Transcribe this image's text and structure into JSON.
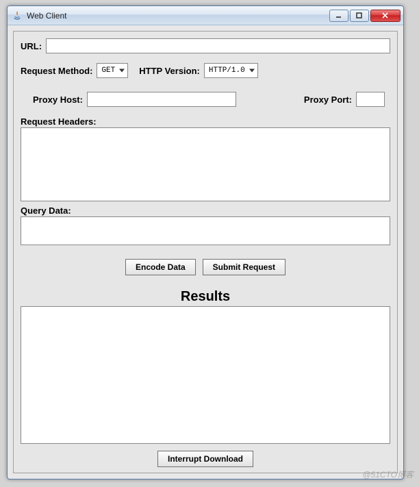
{
  "window": {
    "title": "Web Client"
  },
  "form": {
    "url_label": "URL:",
    "url_value": "",
    "method_label": "Request Method:",
    "method_selected": "GET",
    "http_version_label": "HTTP Version:",
    "http_version_selected": "HTTP/1.0",
    "proxy_host_label": "Proxy Host:",
    "proxy_host_value": "",
    "proxy_port_label": "Proxy Port:",
    "proxy_port_value": "",
    "request_headers_label": "Request Headers:",
    "request_headers_value": "",
    "query_data_label": "Query Data:",
    "query_data_value": ""
  },
  "buttons": {
    "encode": "Encode Data",
    "submit": "Submit Request",
    "interrupt": "Interrupt Download"
  },
  "results": {
    "heading": "Results",
    "value": ""
  },
  "watermark": "@51CTO博客"
}
